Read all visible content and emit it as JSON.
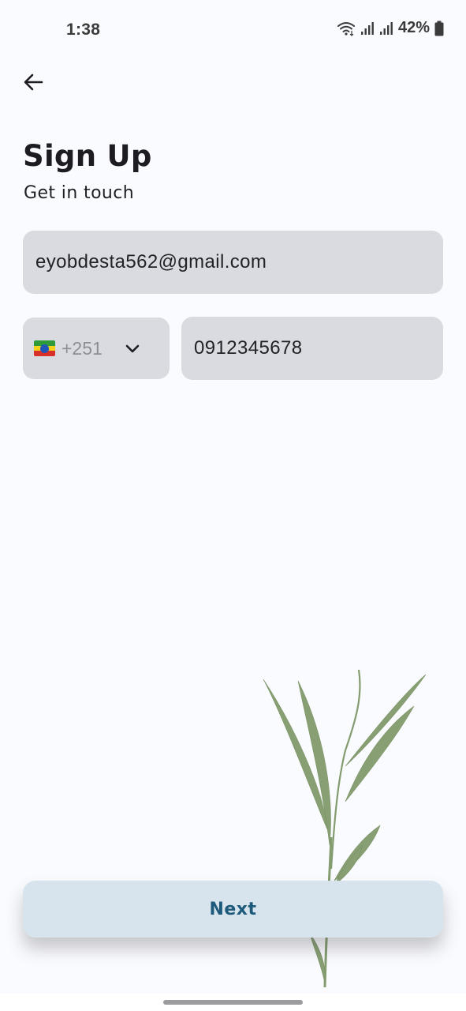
{
  "status_bar": {
    "time": "1:38",
    "battery_percent": "42%",
    "icons": [
      "wifi-icon",
      "signal-icon",
      "signal-icon",
      "battery-icon"
    ]
  },
  "header": {
    "back_icon": "arrow-left-icon"
  },
  "signup": {
    "title": "Sign Up",
    "subtitle": "Get in touch"
  },
  "form": {
    "email_value": "eyobdesta562@gmail.com",
    "country": {
      "flag": "ethiopia-flag-icon",
      "dial_code": "+251",
      "dropdown_icon": "chevron-down-icon"
    },
    "phone_value": "0912345678"
  },
  "actions": {
    "next_label": "Next"
  },
  "colors": {
    "background": "#fafbfe",
    "field_background": "#d9dbe0",
    "button_background": "#d8e4ed",
    "button_text": "#1d5a7c",
    "title_text": "#1c1c22",
    "plant_green": "#7f9868"
  }
}
